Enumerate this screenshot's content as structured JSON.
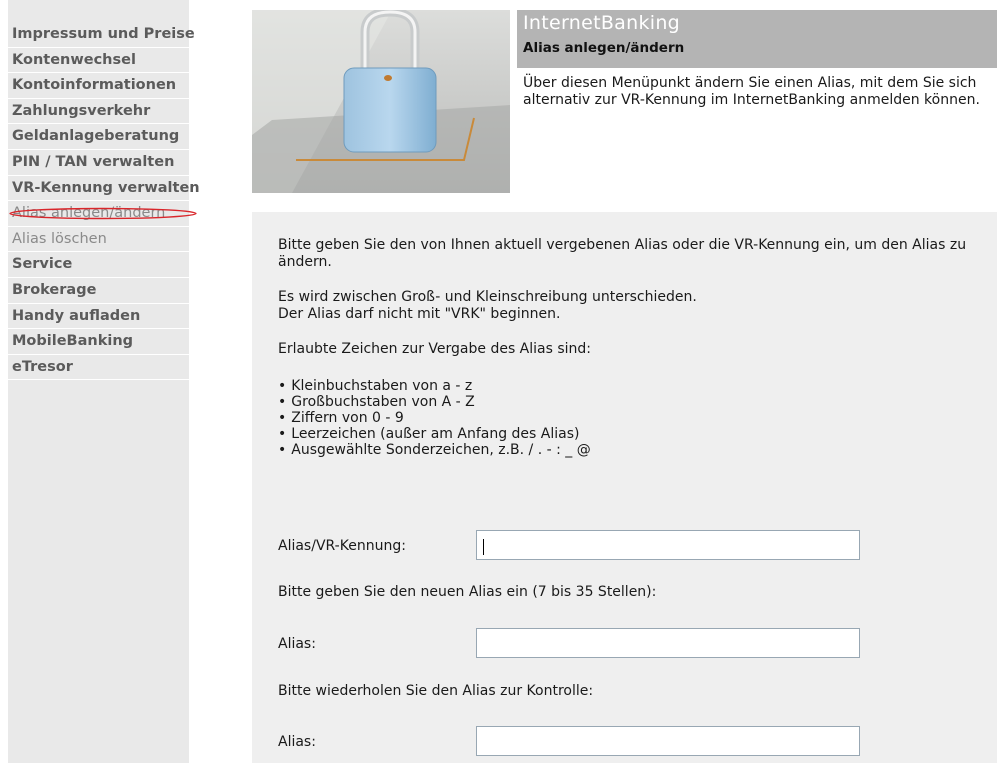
{
  "sidebar": {
    "items": [
      {
        "label": "Impressum und Preise"
      },
      {
        "label": "Kontenwechsel"
      },
      {
        "label": "Kontoinformationen"
      },
      {
        "label": "Zahlungsverkehr"
      },
      {
        "label": "Geldanlageberatung"
      },
      {
        "label": "PIN / TAN verwalten"
      },
      {
        "label": "VR-Kennung verwalten"
      },
      {
        "label": "Alias anlegen/ändern"
      },
      {
        "label": "Alias löschen"
      },
      {
        "label": "Service"
      },
      {
        "label": "Brokerage"
      },
      {
        "label": "Handy aufladen"
      },
      {
        "label": "MobileBanking"
      },
      {
        "label": "eTresor"
      }
    ],
    "annotation_color": "#d9262b"
  },
  "header": {
    "app_title": "InternetBanking",
    "page_subtitle": "Alias anlegen/ändern",
    "intro": "Über diesen Menüpunkt ändern Sie einen Alias, mit dem Sie sich alternativ zur VR-Kennung im InternetBanking anmelden können."
  },
  "main": {
    "para1": "Bitte geben Sie den von Ihnen aktuell vergebenen Alias oder die VR-Kennung ein, um den Alias zu ändern.",
    "para2_line1": "Es wird zwischen Groß- und Kleinschreibung unterschieden.",
    "para2_line2": "Der Alias darf nicht mit \"VRK\" beginnen.",
    "para3": "Erlaubte Zeichen zur Vergabe des Alias sind:",
    "bullets": [
      "Kleinbuchstaben von a - z",
      "Großbuchstaben von A - Z",
      "Ziffern von 0 - 9",
      "Leerzeichen (außer am Anfang des Alias)",
      "Ausgewählte Sonderzeichen, z.B. / . - : _ @"
    ]
  },
  "form": {
    "current_label": "Alias/VR-Kennung:",
    "current_value": "",
    "new_hint": "Bitte geben Sie den neuen Alias ein (7 bis 35 Stellen):",
    "new_label": "Alias:",
    "new_value": "",
    "repeat_hint": "Bitte wiederholen Sie den Alias zur Kontrolle:",
    "repeat_label": "Alias:",
    "repeat_value": ""
  }
}
